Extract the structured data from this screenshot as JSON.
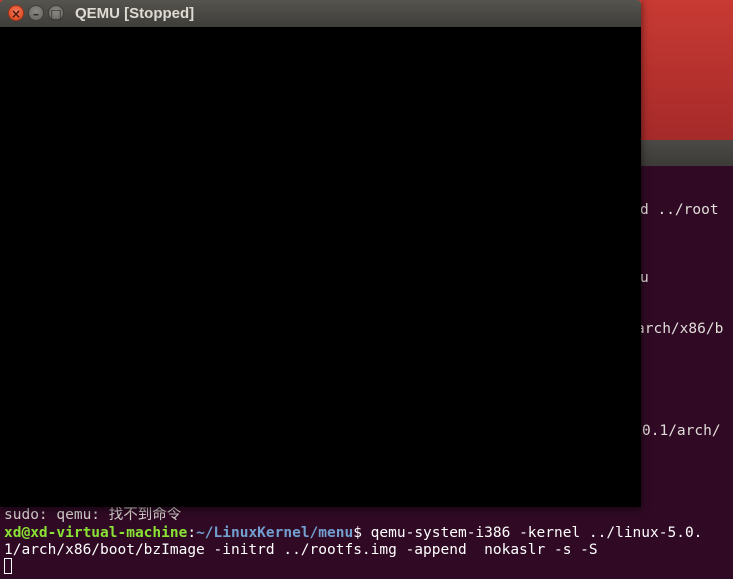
{
  "qemu": {
    "title": "QEMU [Stopped]"
  },
  "terminal": {
    "partial_lines": [
      "d ../root",
      "u",
      "arch/x86/b",
      "0.1/arch/"
    ],
    "sudo_message": "sudo: qemu: 找不到命令",
    "prompt_user": "xd@xd-virtual-machine",
    "prompt_sep": ":",
    "prompt_path": "~/LinuxKernel/menu",
    "prompt_symbol": "$",
    "command_line_1": " qemu-system-i386 -kernel ../linux-5.0.",
    "command_line_2": "1/arch/x86/boot/bzImage -initrd ../rootfs.img -append  nokaslr -s -S"
  },
  "colors": {
    "desktop_accent": "#c83a33",
    "terminal_bg": "#300a24",
    "prompt_user": "#8ae234",
    "prompt_path": "#729fcf",
    "qemu_display": "#000000"
  }
}
